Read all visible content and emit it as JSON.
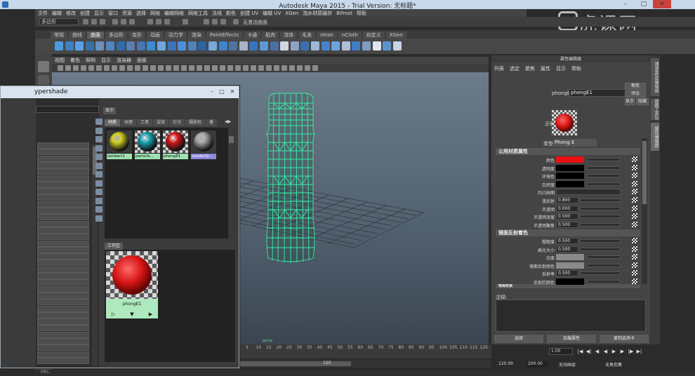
{
  "window": {
    "title": "Autodesk Maya 2015 - Trial Version: 无标题*"
  },
  "menubar": [
    "文件",
    "编辑",
    "修改",
    "创建",
    "显示",
    "窗口",
    "资源",
    "选择",
    "网格",
    "编辑网格",
    "网格工具",
    "法线",
    "颜色",
    "创建 UV",
    "编辑 UV",
    "XGen",
    "泡水材质缓存",
    "Bifrost",
    "帮助"
  ],
  "statusline": {
    "mode": "多边形",
    "no_selection": "无激活曲面"
  },
  "shelf": {
    "tabs": [
      "常规",
      "曲线",
      "曲面",
      "多边形",
      "变形",
      "动画",
      "动力学",
      "渲染",
      "PaintEffects",
      "卡通",
      "肌肉",
      "流体",
      "毛发",
      "nHair",
      "nCloth",
      "自定义",
      "XGen"
    ],
    "active_tab": "曲面"
  },
  "viewport": {
    "menu": [
      "视图",
      "着色",
      "照明",
      "显示",
      "渲染器",
      "面板"
    ],
    "camera_label": "persp"
  },
  "timeline": {
    "ticks": [
      "5",
      "10",
      "15",
      "20",
      "25",
      "30",
      "35",
      "40",
      "45",
      "50",
      "55",
      "60",
      "65",
      "70",
      "75",
      "80",
      "85",
      "90",
      "95",
      "100",
      "105",
      "110",
      "115",
      "120"
    ],
    "range_value": "120",
    "current_frame": "1.00",
    "range_start": "120.00",
    "range_end": "200.00",
    "anim_layer": "无动画层",
    "char_set": "无角色集"
  },
  "attribute_editor": {
    "title": "属性编辑器",
    "menu": [
      "列表",
      "选定",
      "聚焦",
      "属性",
      "显示",
      "帮助"
    ],
    "node_label": "phongE:",
    "node_name": "phongE1",
    "buttons": {
      "focus": "聚焦",
      "presets": "预设",
      "show": "显示",
      "hide": "隐藏"
    },
    "sample_label": "示例",
    "type_label": "类型",
    "type_value": "Phong E",
    "section_common": "公用材质属性",
    "common_rows": [
      {
        "label": "颜色",
        "kind": "color",
        "color": "#e81010"
      },
      {
        "label": "透明度",
        "kind": "color",
        "color": "#000000"
      },
      {
        "label": "环境色",
        "kind": "color",
        "color": "#000000"
      },
      {
        "label": "白炽度",
        "kind": "color",
        "color": "#000000"
      },
      {
        "label": "凹凸贴图",
        "kind": "wide"
      },
      {
        "label": "漫反射",
        "kind": "num",
        "value": "0.800"
      },
      {
        "label": "半透明",
        "kind": "num",
        "value": "0.000"
      },
      {
        "label": "半透明深度",
        "kind": "num",
        "value": "0.500"
      },
      {
        "label": "半透明聚焦",
        "kind": "num",
        "value": "0.500"
      }
    ],
    "section_specular": "镜面反射着色",
    "specular_rows": [
      {
        "label": "粗糙度",
        "kind": "num",
        "value": "0.500"
      },
      {
        "label": "高光大小",
        "kind": "num",
        "value": "0.500"
      },
      {
        "label": "白度",
        "kind": "color",
        "color": "#8a8a8a"
      },
      {
        "label": "镜面反射颜色",
        "kind": "color",
        "color": "#8a8a8a"
      },
      {
        "label": "反射率",
        "kind": "num",
        "value": "0.500"
      },
      {
        "label": "反射的颜色",
        "kind": "color",
        "color": "#000000"
      }
    ],
    "section_more": "特殊效果",
    "notes_label": "注释:",
    "bottom_buttons": [
      "选择",
      "加载属性",
      "复制选项卡"
    ]
  },
  "right_tabs": [
    "通道盒/层编辑器",
    "建模工具包",
    "属性编辑器"
  ],
  "hypershade": {
    "title": "ypershade",
    "show_button": "显示",
    "tabs": [
      "材质",
      "纹理",
      "工具",
      "渲染",
      "灯光",
      "摄影机",
      "着"
    ],
    "active_tab": "材质",
    "materials": [
      {
        "name": "lambert1",
        "color": "#d4d020",
        "checker": false,
        "highlight": false
      },
      {
        "name": "particle...",
        "color": "#1aa6b8",
        "checker": true,
        "highlight": false
      },
      {
        "name": "phongE1",
        "color": "#d81818",
        "checker": true,
        "highlight": false
      },
      {
        "name": "shaderGl...",
        "color": "#a8a8a8",
        "checker": false,
        "highlight": true
      }
    ],
    "work_tab": "工作区",
    "work_node_label": "phongE1"
  },
  "watermark": "虎课网"
}
